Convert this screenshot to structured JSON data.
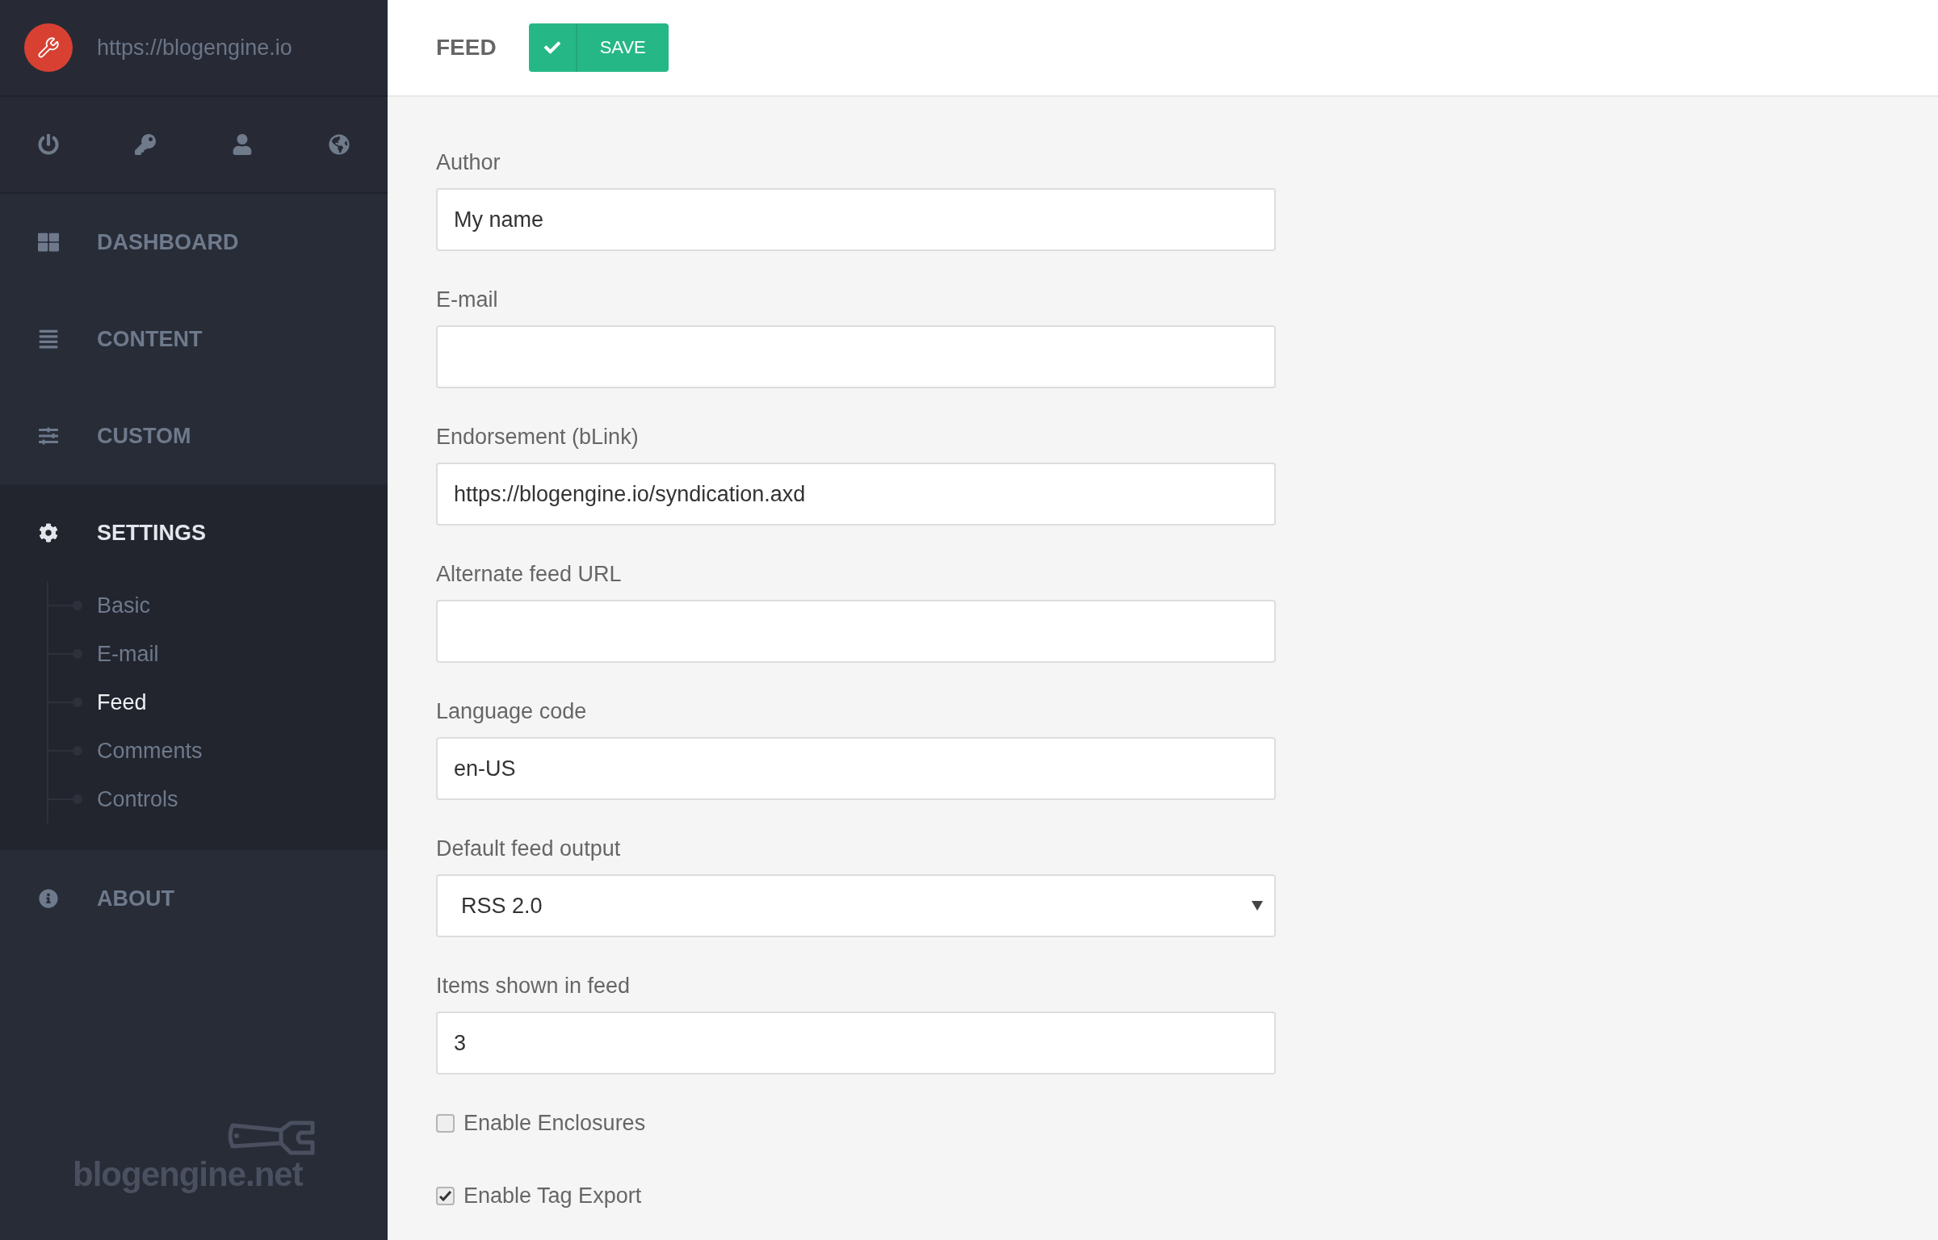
{
  "sidebar": {
    "site_url": "https://blogengine.io",
    "nav": [
      {
        "label": "DASHBOARD",
        "selected": false
      },
      {
        "label": "CONTENT",
        "selected": false
      },
      {
        "label": "CUSTOM",
        "selected": false
      },
      {
        "label": "SETTINGS",
        "selected": true,
        "children": [
          {
            "label": "Basic",
            "selected": false
          },
          {
            "label": "E-mail",
            "selected": false
          },
          {
            "label": "Feed",
            "selected": true
          },
          {
            "label": "Comments",
            "selected": false
          },
          {
            "label": "Controls",
            "selected": false
          }
        ]
      },
      {
        "label": "ABOUT",
        "selected": false
      }
    ],
    "logo_text": "blogengine.net"
  },
  "header": {
    "title": "FEED",
    "save_button": "SAVE"
  },
  "form": {
    "fields": [
      {
        "kind": "text",
        "label": "Author",
        "value": "My name"
      },
      {
        "kind": "text",
        "label": "E-mail"
      },
      {
        "kind": "text",
        "label": "Endorsement (bLink)",
        "value": "https://blogengine.io/syndication.axd"
      },
      {
        "kind": "text",
        "label": "Alternate feed URL"
      },
      {
        "kind": "text",
        "label": "Language code",
        "value": "en-US"
      },
      {
        "kind": "select",
        "label": "Default feed output",
        "value": "RSS 2.0"
      },
      {
        "kind": "text",
        "label": "Items shown in feed",
        "value": "3"
      }
    ],
    "checkboxes": [
      {
        "label": "Enable Enclosures",
        "checked": false
      },
      {
        "label": "Enable Tag Export",
        "checked": true
      }
    ]
  }
}
